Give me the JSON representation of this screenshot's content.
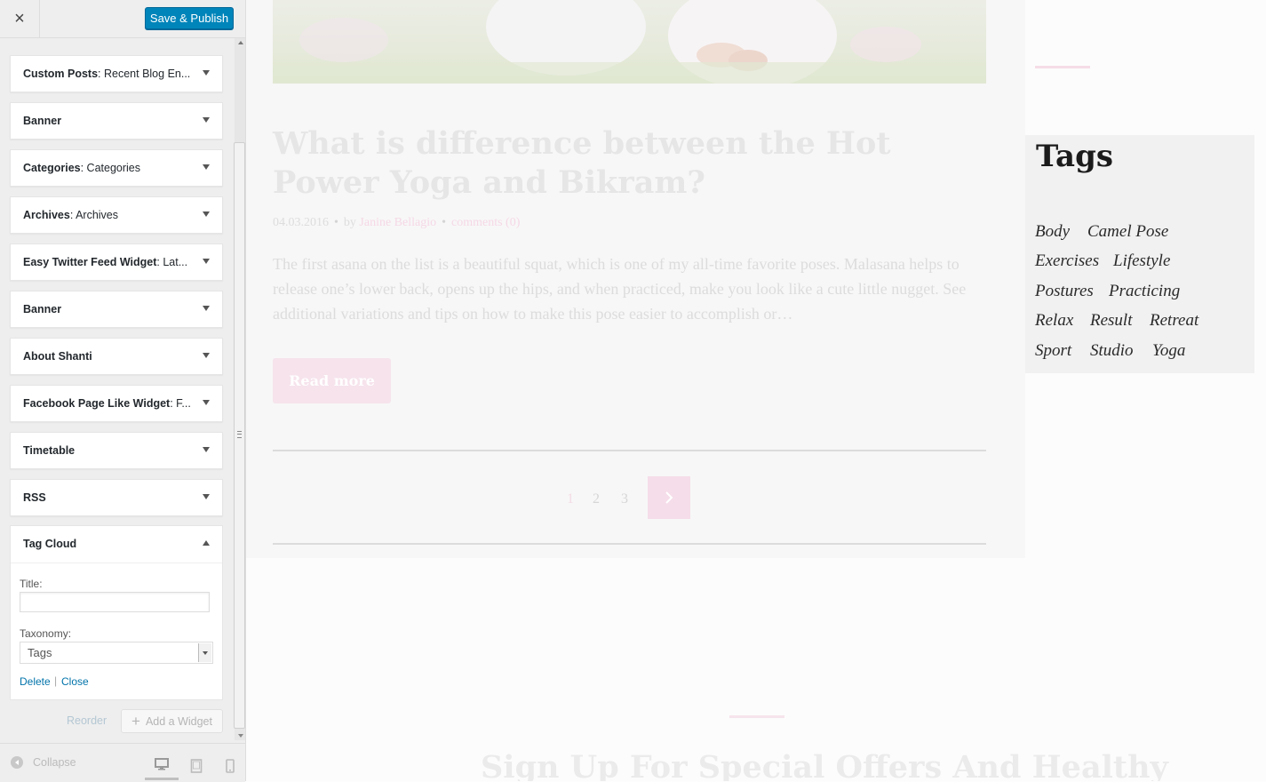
{
  "sidebar": {
    "close_label": "×",
    "save_label": "Save & Publish",
    "widgets": [
      {
        "name": "Custom Posts",
        "subtitle": ": Recent Blog En..."
      },
      {
        "name": "Banner",
        "subtitle": ""
      },
      {
        "name": "Categories",
        "subtitle": ": Categories"
      },
      {
        "name": "Archives",
        "subtitle": ": Archives"
      },
      {
        "name": "Easy Twitter Feed Widget",
        "subtitle": ": Lat..."
      },
      {
        "name": "Banner",
        "subtitle": ""
      },
      {
        "name": "About Shanti",
        "subtitle": ""
      },
      {
        "name": "Facebook Page Like Widget",
        "subtitle": ": F..."
      },
      {
        "name": "Timetable",
        "subtitle": ""
      },
      {
        "name": "RSS",
        "subtitle": ""
      }
    ],
    "tag_cloud": {
      "name": "Tag Cloud",
      "title_label": "Title:",
      "title_value": "",
      "taxonomy_label": "Taxonomy:",
      "taxonomy_value": "Tags",
      "delete_label": "Delete",
      "separator": "|",
      "close_label": "Close"
    },
    "reorder_label": "Reorder",
    "add_widget_label": "Add a Widget",
    "collapse_label": "Collapse",
    "accent_color": "#0085ba",
    "link_color": "#0073aa",
    "icons": [
      "close-icon",
      "plus-icon",
      "collapse-icon",
      "desktop-icon",
      "tablet-icon",
      "mobile-icon"
    ]
  },
  "preview": {
    "post": {
      "title": "What is difference between the Hot Power Yoga and Bikram?",
      "date": "04.03.2016",
      "by_label": "by",
      "author": "Janine Bellagio",
      "comments": "comments (0)",
      "excerpt": "The first asana on the list is a beautiful squat, which is one of my all-time favorite poses. Malasana helps to release one’s lower back, opens up the hips, and when practiced, make you look like a cute little nugget. See additional variations and tips on how to make this pose easier to accomplish or…",
      "read_more": "Read more"
    },
    "pagination": {
      "pages": [
        "1",
        "2",
        "3"
      ],
      "next_icon": "chevron-right-icon"
    },
    "tags_widget": {
      "heading": "Tags",
      "tags": [
        "Body",
        "Camel Pose",
        "Exercises",
        "Lifestyle",
        "Postures",
        "Practicing",
        "Relax",
        "Result",
        "Retreat",
        "Sport",
        "Studio",
        "Yoga"
      ]
    },
    "signup_heading": "Sign Up For Special Offers And Healthy",
    "accent_color": "#f5dde9"
  }
}
